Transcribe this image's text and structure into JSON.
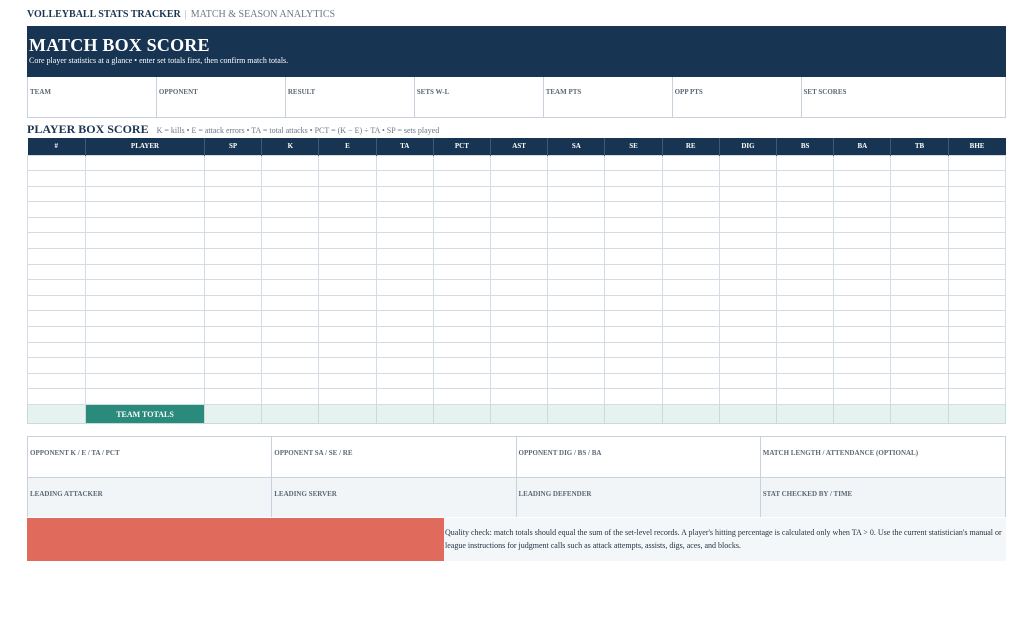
{
  "topbar": {
    "app_title": "VOLLEYBALL STATS TRACKER",
    "separator": "|",
    "section": "MATCH & SEASON ANALYTICS"
  },
  "banner": {
    "title": "MATCH BOX SCORE",
    "subtitle": "Core player statistics at a glance • enter set totals first, then confirm match totals."
  },
  "meta_fields": [
    "TEAM",
    "OPPONENT",
    "RESULT",
    "SETS W-L",
    "TEAM PTS",
    "OPP PTS",
    "SET SCORES"
  ],
  "player_box": {
    "heading": "PLAYER BOX SCORE",
    "legend": "K = kills  •  E = attack errors  •  TA = total attacks  •  PCT = (K − E) ÷ TA  •  SP = sets played",
    "columns": [
      "#",
      "PLAYER",
      "SP",
      "K",
      "E",
      "TA",
      "PCT",
      "AST",
      "SA",
      "SE",
      "RE",
      "DIG",
      "BS",
      "BA",
      "TB",
      "BHE"
    ],
    "team_totals_label": "TEAM TOTALS"
  },
  "opponent_fields": [
    "OPPONENT K / E / TA / PCT",
    "OPPONENT SA / SE / RE",
    "OPPONENT DIG / BS / BA",
    "MATCH LENGTH / ATTENDANCE (OPTIONAL)"
  ],
  "leader_fields": [
    "LEADING ATTACKER",
    "LEADING SERVER",
    "LEADING DEFENDER",
    "STAT CHECKED BY / TIME"
  ],
  "quality_note": "Quality check: match totals should equal the sum of the set-level records. A player's hitting percentage is calculated only when TA > 0. Use the current statistician's manual or league instructions for judgment calls such as attack attempts, assists, digs, aces, and blocks.",
  "colors": {
    "navy": "#183453",
    "teal": "#2a8a7c",
    "coral": "#e06a5b",
    "totals_row": "#e6f2ef"
  }
}
